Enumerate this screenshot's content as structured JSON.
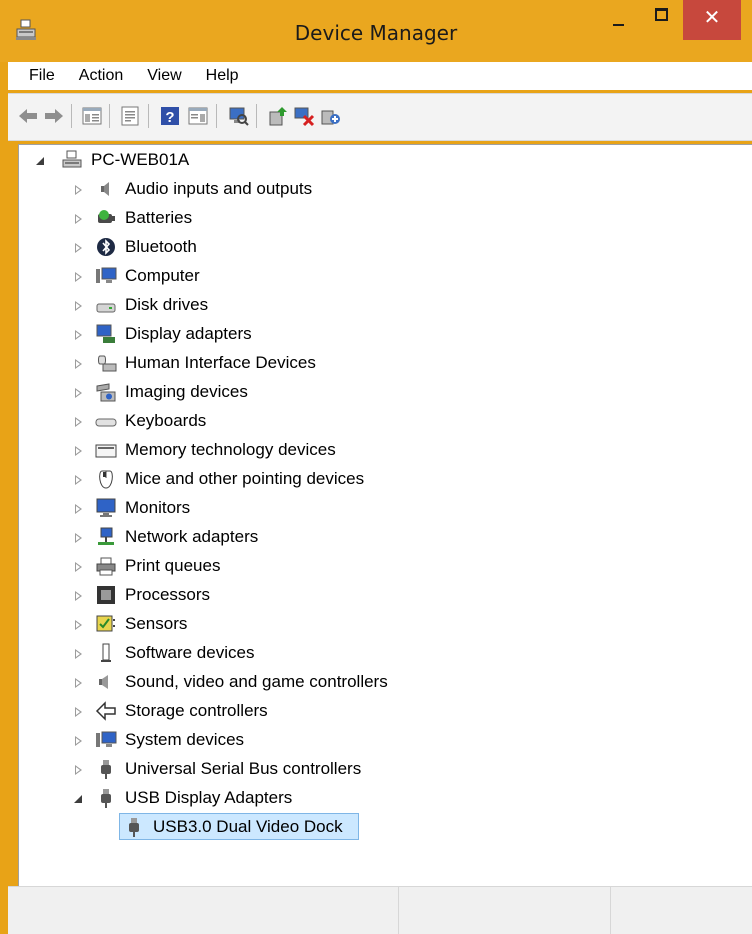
{
  "window": {
    "title": "Device Manager",
    "close_glyph": "✕",
    "accent_color": "#eaa71f",
    "close_color": "#c7483d"
  },
  "menu": [
    "File",
    "Action",
    "View",
    "Help"
  ],
  "toolbar": [
    "back-icon",
    "forward-icon",
    "show-hide-console-tree-icon",
    "properties-icon",
    "export-list-icon",
    "help-icon",
    "show-hide-action-pane-icon",
    "scan-for-hardware-changes-icon",
    "update-driver-icon",
    "uninstall-device-icon",
    "add-legacy-hardware-icon"
  ],
  "tree": {
    "root": "PC-WEB01A",
    "categories": [
      {
        "label": "Audio inputs and outputs",
        "icon": "speaker-icon"
      },
      {
        "label": "Batteries",
        "icon": "battery-icon"
      },
      {
        "label": "Bluetooth",
        "icon": "bluetooth-icon"
      },
      {
        "label": "Computer",
        "icon": "computer-icon"
      },
      {
        "label": "Disk drives",
        "icon": "disk-drive-icon"
      },
      {
        "label": "Display adapters",
        "icon": "display-adapter-icon"
      },
      {
        "label": "Human Interface Devices",
        "icon": "hid-icon"
      },
      {
        "label": "Imaging devices",
        "icon": "camera-icon"
      },
      {
        "label": "Keyboards",
        "icon": "keyboard-icon"
      },
      {
        "label": "Memory technology devices",
        "icon": "memory-card-icon"
      },
      {
        "label": "Mice and other pointing devices",
        "icon": "mouse-icon"
      },
      {
        "label": "Monitors",
        "icon": "monitor-icon"
      },
      {
        "label": "Network adapters",
        "icon": "network-adapter-icon"
      },
      {
        "label": "Print queues",
        "icon": "printer-icon"
      },
      {
        "label": "Processors",
        "icon": "processor-icon"
      },
      {
        "label": "Sensors",
        "icon": "sensor-icon"
      },
      {
        "label": "Software devices",
        "icon": "software-device-icon"
      },
      {
        "label": "Sound, video and game controllers",
        "icon": "sound-icon"
      },
      {
        "label": "Storage controllers",
        "icon": "storage-controller-icon"
      },
      {
        "label": "System devices",
        "icon": "system-device-icon"
      },
      {
        "label": "Universal Serial Bus controllers",
        "icon": "usb-plug-icon"
      },
      {
        "label": "USB Display Adapters",
        "icon": "usb-plug-icon",
        "expanded": true
      }
    ],
    "child": {
      "label": "USB3.0 Dual Video Dock",
      "icon": "usb-plug-icon",
      "selected": true
    }
  }
}
